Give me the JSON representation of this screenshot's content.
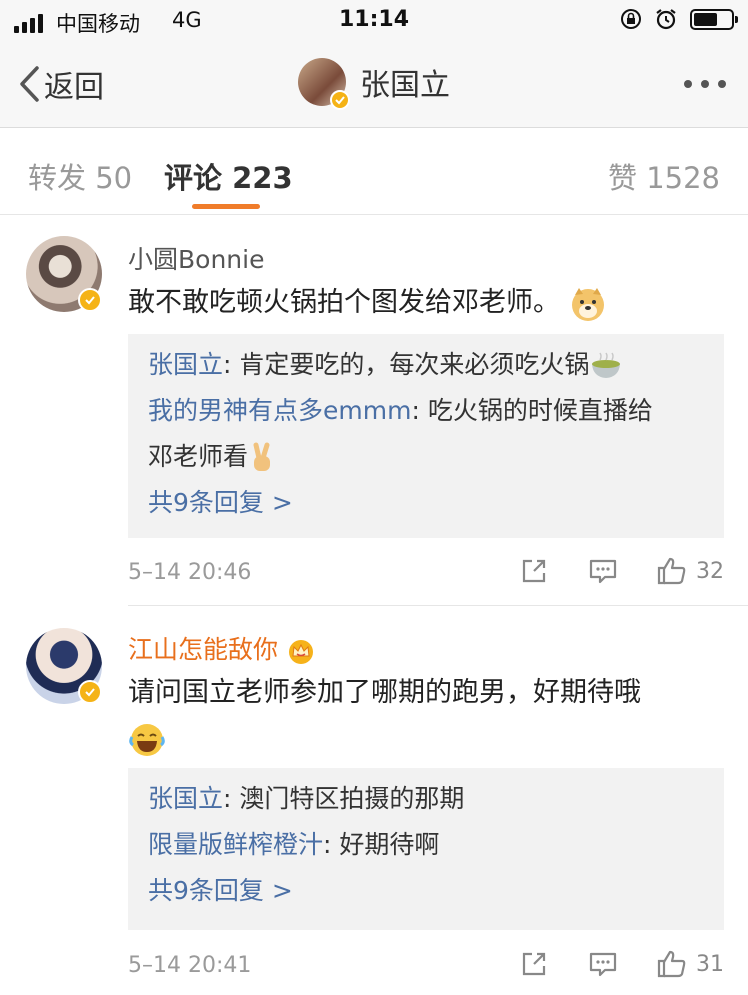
{
  "status_bar": {
    "carrier": "中国移动",
    "network": "4G",
    "time": "11:14",
    "battery_level": 0.65
  },
  "nav": {
    "back_label": "返回",
    "title": "张国立"
  },
  "tabs": [
    {
      "label": "转发",
      "count": "50"
    },
    {
      "label": "评论",
      "count": "223"
    },
    {
      "label": "赞",
      "count": "1528"
    }
  ],
  "active_tab": "评论",
  "comments": [
    {
      "username": "小圆Bonnie",
      "username_color": "#555555",
      "text": "敢不敢吃顿火锅拍个图发给邓老师。",
      "text_emoji": "doge-emoji",
      "replies": [
        {
          "user": "张国立",
          "text": "肯定要吃的，每次来必须吃火锅"
        },
        {
          "user": "我的男神有点多emmm",
          "text": "吃火锅的时候直播给",
          "text_cont": "邓老师看"
        }
      ],
      "more_replies": "共9条回复 >",
      "time": "5–14 20:46",
      "likes": "32"
    },
    {
      "username": "江山怎能敌你",
      "username_color": "#e86f1c",
      "text": "请问国立老师参加了哪期的跑男，好期待哦",
      "text_emoji": "laugh-cry-emoji",
      "replies": [
        {
          "user": "张国立",
          "text": "澳门特区拍摄的那期"
        },
        {
          "user": "限量版鲜榨橙汁",
          "text": "好期待啊"
        }
      ],
      "more_replies": "共9条回复 >",
      "time": "5–14 20:41",
      "likes": "31"
    }
  ],
  "colors": {
    "accent": "#f07c2a",
    "link": "#4a6fa5",
    "verify": "#f5b316"
  }
}
